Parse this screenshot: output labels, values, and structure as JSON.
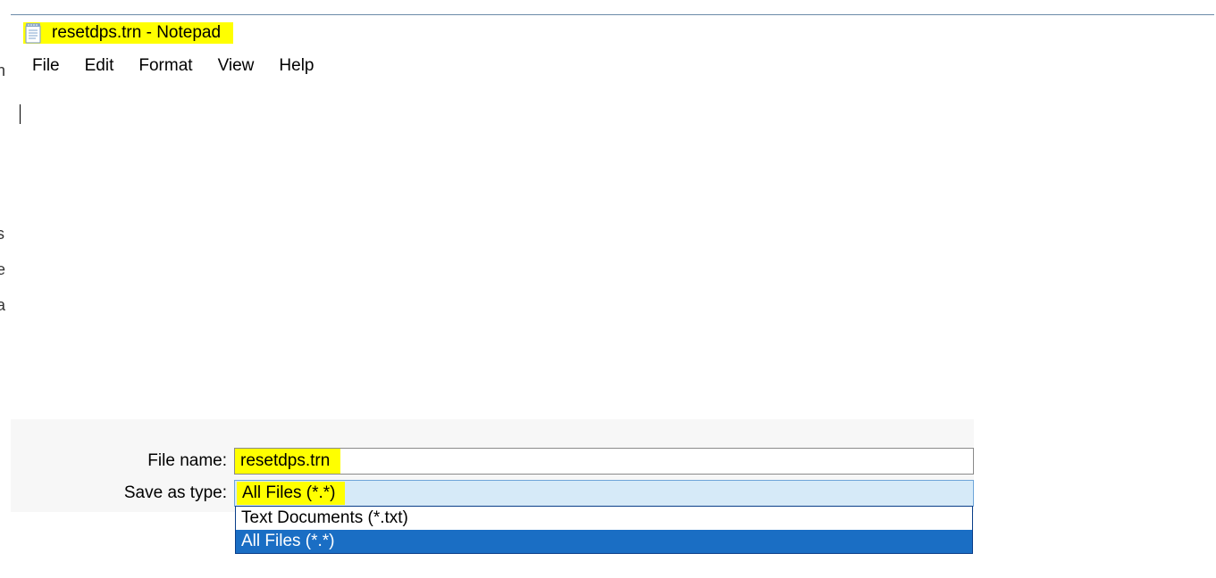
{
  "window": {
    "title": "resetdps.trn - Notepad",
    "icon": "notepad-icon"
  },
  "menubar": {
    "items": [
      "File",
      "Edit",
      "Format",
      "View",
      "Help"
    ]
  },
  "editor": {
    "content": ""
  },
  "save_dialog": {
    "filename_label": "File name:",
    "filename_value": "resetdps.trn",
    "type_label": "Save as type:",
    "type_selected": "All Files  (*.*)",
    "type_options": [
      "Text Documents (*.txt)",
      "All Files  (*.*)"
    ]
  },
  "left_hints": [
    "h",
    "s",
    "e",
    "a"
  ]
}
